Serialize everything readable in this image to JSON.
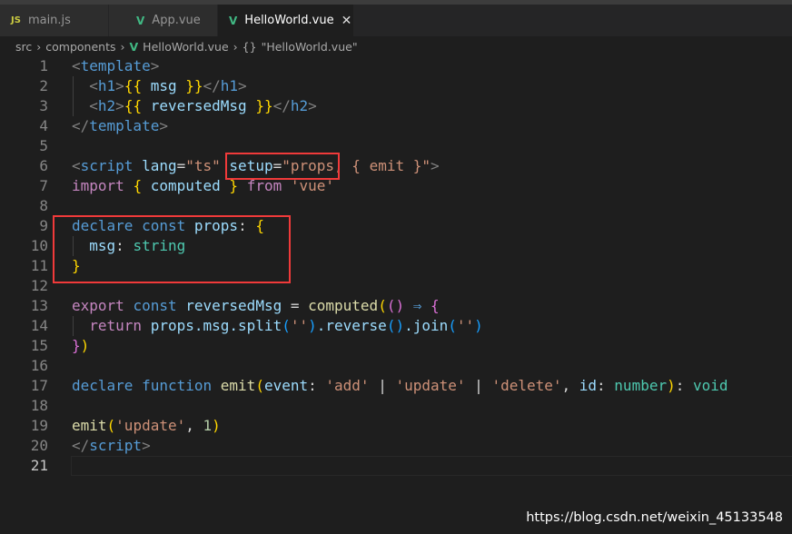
{
  "tabs": [
    {
      "icon": "JS",
      "label": "main.js",
      "active": false
    },
    {
      "icon": "V",
      "label": "App.vue",
      "active": false
    },
    {
      "icon": "V",
      "label": "HelloWorld.vue",
      "active": true,
      "close": "✕"
    }
  ],
  "breadcrumb": {
    "items": [
      "src",
      "components",
      "HelloWorld.vue",
      "\"HelloWorld.vue\""
    ],
    "separator": "›",
    "braces_icon": "{}"
  },
  "colors": {
    "highlight_box": "#f03a3a",
    "background": "#1e1e1e"
  },
  "current_line": 21,
  "code_lines": [
    [
      [
        "<",
        "p"
      ],
      [
        "template",
        "t"
      ],
      [
        ">",
        "p"
      ]
    ],
    [
      [
        "  "
      ],
      [
        "<",
        "p"
      ],
      [
        "h1",
        "t"
      ],
      [
        ">",
        "p"
      ],
      [
        "{{",
        "y"
      ],
      [
        " msg ",
        "v"
      ],
      [
        "}}",
        "y"
      ],
      [
        "</",
        "p"
      ],
      [
        "h1",
        "t"
      ],
      [
        ">",
        "p"
      ]
    ],
    [
      [
        "  "
      ],
      [
        "<",
        "p"
      ],
      [
        "h2",
        "t"
      ],
      [
        ">",
        "p"
      ],
      [
        "{{",
        "y"
      ],
      [
        " reversedMsg ",
        "v"
      ],
      [
        "}}",
        "y"
      ],
      [
        "</",
        "p"
      ],
      [
        "h2",
        "t"
      ],
      [
        ">",
        "p"
      ]
    ],
    [
      [
        "</",
        "p"
      ],
      [
        "template",
        "t"
      ],
      [
        ">",
        "p"
      ]
    ],
    [],
    [
      [
        "<",
        "p"
      ],
      [
        "script",
        "t"
      ],
      [
        " "
      ],
      [
        "lang",
        "a"
      ],
      [
        "=",
        "d"
      ],
      [
        "\"ts\"",
        "s"
      ],
      [
        " "
      ],
      [
        "setup",
        "a"
      ],
      [
        "=",
        "d"
      ],
      [
        "\"props, { emit }\"",
        "s"
      ],
      [
        ">",
        "p"
      ]
    ],
    [
      [
        "import",
        "k"
      ],
      [
        " "
      ],
      [
        "{",
        "y"
      ],
      [
        " computed ",
        "v"
      ],
      [
        "}",
        "y"
      ],
      [
        " "
      ],
      [
        "from",
        "k"
      ],
      [
        " "
      ],
      [
        "'vue'",
        "s"
      ]
    ],
    [],
    [
      [
        "declare",
        "b"
      ],
      [
        " "
      ],
      [
        "const",
        "b"
      ],
      [
        " "
      ],
      [
        "props",
        "v"
      ],
      [
        ": ",
        "d"
      ],
      [
        "{",
        "y"
      ]
    ],
    [
      [
        "  "
      ],
      [
        "msg",
        "v"
      ],
      [
        ": ",
        "d"
      ],
      [
        "string",
        "ty"
      ]
    ],
    [
      [
        "}",
        "y"
      ]
    ],
    [],
    [
      [
        "export",
        "k"
      ],
      [
        " "
      ],
      [
        "const",
        "b"
      ],
      [
        " "
      ],
      [
        "reversedMsg",
        "v"
      ],
      [
        " = ",
        "d"
      ],
      [
        "computed",
        "f"
      ],
      [
        "(",
        "y"
      ],
      [
        "()",
        "m"
      ],
      [
        " ⇒ ",
        "b"
      ],
      [
        "{",
        "m"
      ]
    ],
    [
      [
        "  "
      ],
      [
        "return",
        "k"
      ],
      [
        " "
      ],
      [
        "props.msg.split",
        "v"
      ],
      [
        "(",
        "c"
      ],
      [
        "''",
        "s"
      ],
      [
        ")",
        "c"
      ],
      [
        ".reverse",
        "v"
      ],
      [
        "()",
        "c"
      ],
      [
        ".join",
        "v"
      ],
      [
        "(",
        "c"
      ],
      [
        "''",
        "s"
      ],
      [
        ")",
        "c"
      ]
    ],
    [
      [
        "}",
        "m"
      ],
      [
        ")",
        "y"
      ]
    ],
    [],
    [
      [
        "declare",
        "b"
      ],
      [
        " "
      ],
      [
        "function",
        "b"
      ],
      [
        " "
      ],
      [
        "emit",
        "f"
      ],
      [
        "(",
        "y"
      ],
      [
        "event",
        "v"
      ],
      [
        ": ",
        "d"
      ],
      [
        "'add'",
        "s"
      ],
      [
        " | ",
        "d"
      ],
      [
        "'update'",
        "s"
      ],
      [
        " | ",
        "d"
      ],
      [
        "'delete'",
        "s"
      ],
      [
        ", ",
        "d"
      ],
      [
        "id",
        "v"
      ],
      [
        ": ",
        "d"
      ],
      [
        "number",
        "ty"
      ],
      [
        ")",
        "y"
      ],
      [
        ": ",
        "d"
      ],
      [
        "void",
        "ty"
      ]
    ],
    [],
    [
      [
        "emit",
        "f"
      ],
      [
        "(",
        "y"
      ],
      [
        "'update'",
        "s"
      ],
      [
        ", ",
        "d"
      ],
      [
        "1",
        "n"
      ],
      [
        ")",
        "y"
      ]
    ],
    [
      [
        "</",
        "p"
      ],
      [
        "script",
        "t"
      ],
      [
        ">",
        "p"
      ]
    ],
    []
  ],
  "watermark": "https://blog.csdn.net/weixin_45133548"
}
